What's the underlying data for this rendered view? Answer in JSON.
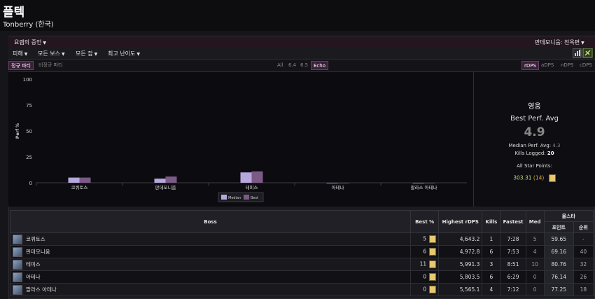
{
  "header": {
    "character_name": "플텍",
    "server": "Tonberry (한국)"
  },
  "bar1": {
    "zone_dropdown": "요렘의 증언",
    "spec_dropdown": "판데모니움: 천옥편"
  },
  "bar2": {
    "metric_dropdown": "피해",
    "boss_dropdown": "모든 보스",
    "job_dropdown": "모든 잡",
    "difficulty_dropdown": "최고 난이도"
  },
  "bar3": {
    "party_tabs": [
      "정규 파티",
      "비정규 파티"
    ],
    "patch_tabs": [
      "All",
      "6.4",
      "6.5",
      "Echo"
    ],
    "dps_tabs": [
      "rDPS",
      "aDPS",
      "nDPS",
      "cDPS"
    ]
  },
  "chart_data": {
    "type": "bar",
    "categories": [
      "코퀴토스",
      "판데모니움",
      "테미스",
      "아테나",
      "팔라스 아테나"
    ],
    "series": [
      {
        "name": "Median",
        "values": [
          5,
          4,
          10,
          0,
          0
        ]
      },
      {
        "name": "Best",
        "values": [
          5,
          6,
          11,
          0,
          0
        ]
      }
    ],
    "ylabel": "Perf %",
    "ylim": [
      0,
      100
    ],
    "yticks": [
      0,
      25,
      50,
      75,
      100
    ],
    "grid": false,
    "legend": "bottom-center",
    "colors": {
      "Median": "#b7a7dd",
      "Best": "#7c5a86"
    }
  },
  "side": {
    "title": "영웅",
    "best_perf_label": "Best Perf. Avg",
    "best_perf_value": "4.9",
    "median_label": "Median Perf. Avg:",
    "median_value": "4.3",
    "kills_label": "Kills Logged:",
    "kills_value": "20",
    "star_label": "All Star Points:",
    "star_points": "303.31",
    "star_rank": "(14)"
  },
  "table": {
    "headers": [
      "Boss",
      "Best %",
      "Highest rDPS",
      "Kills",
      "Fastest",
      "Med",
      "올스타",
      "포인트",
      "순위"
    ],
    "rows": [
      {
        "boss": "코퀴토스",
        "best": "5",
        "rdps": "4,643.2",
        "kills": "1",
        "fastest": "7:28",
        "med": "5",
        "points": "59.65",
        "rank": "-"
      },
      {
        "boss": "판데모니움",
        "best": "6",
        "rdps": "4,972.8",
        "kills": "6",
        "fastest": "7:53",
        "med": "4",
        "points": "69.16",
        "rank": "40"
      },
      {
        "boss": "테미스",
        "best": "11",
        "rdps": "5,991.3",
        "kills": "3",
        "fastest": "8:51",
        "med": "10",
        "points": "80.76",
        "rank": "32"
      },
      {
        "boss": "아테나",
        "best": "0",
        "rdps": "5,803.5",
        "kills": "6",
        "fastest": "6:29",
        "med": "0",
        "points": "76.14",
        "rank": "26"
      },
      {
        "boss": "팔라스 아테나",
        "best": "0",
        "rdps": "5,565.1",
        "kills": "4",
        "fastest": "7:12",
        "med": "0",
        "points": "77.25",
        "rank": "18"
      }
    ]
  }
}
